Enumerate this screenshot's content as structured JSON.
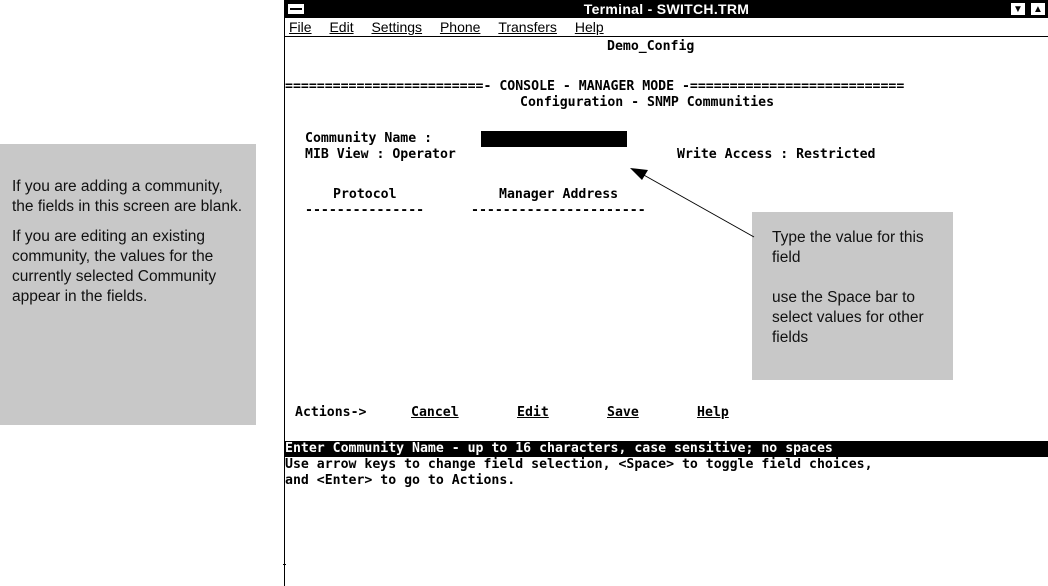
{
  "window": {
    "title": "Terminal - SWITCH.TRM",
    "menu": [
      "File",
      "Edit",
      "Settings",
      "Phone",
      "Transfers",
      "Help"
    ]
  },
  "terminal": {
    "host": "Demo_Config",
    "banner": "=========================- CONSOLE - MANAGER MODE -===========================",
    "subtitle": "Configuration - SNMP Communities",
    "community_label": "Community Name :",
    "community_value": "",
    "mib_label": "MIB View : Operator",
    "write_label": "Write Access : Restricted",
    "col_protocol": "Protocol",
    "col_manager": "Manager Address",
    "col_protocol_rule": "---------------",
    "col_manager_rule": "----------------------",
    "actions": {
      "label": "Actions->",
      "cancel": "Cancel",
      "edit": "Edit",
      "save": "Save",
      "help": "Help"
    },
    "status_line": "Enter Community Name - up to 16 characters, case sensitive; no spaces",
    "help_line1": "Use arrow keys to change field selection, <Space> to toggle field choices,",
    "help_line2": "and <Enter> to go to Actions."
  },
  "callouts": {
    "left_p1": "If you are adding a community, the fields in this screen are blank.",
    "left_p2": "If you are editing an existing community, the values for the currently selected Community appear in the fields.",
    "right_p1": "Type the value for this field",
    "right_p2": "use the Space bar to select values for other fields"
  }
}
